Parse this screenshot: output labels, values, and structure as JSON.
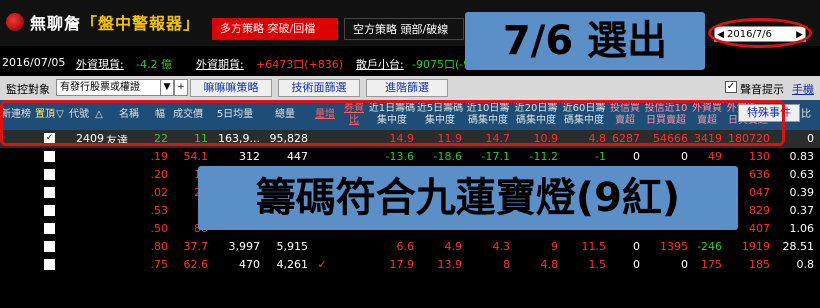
{
  "title": {
    "app_prefix": "無聊詹",
    "app_bracket_l": "「",
    "app_highlight": "盤中警報器",
    "app_bracket_r": "」",
    "bull_strategy": "多方策略  突破/回檔",
    "bear_strategy": "空方策略  頭部/破線",
    "date_value": "2016/7/6"
  },
  "overlay": {
    "top_text": "7/6 選出",
    "mid_text": "籌碼符合九蓮寶燈(9紅)"
  },
  "info": {
    "date": "2016/07/05",
    "foreign_spot_label": "外資現貨:",
    "foreign_spot_value": "-4.2 億",
    "foreign_futures_label": "外資期貨:",
    "foreign_futures_value": "+6473口(+836)",
    "retail_label": "散戶小台:",
    "retail_value": "-9075口(-987)"
  },
  "settings": {
    "monitor_label": "監控對象",
    "monitor_value": "有發行股票或權證",
    "btn_clear": "嘛嘛嘛策略",
    "btn_tech": "技術面篩選",
    "btn_advanced": "進階篩選",
    "sound_label": "聲音提示",
    "hand_label": "手機",
    "special_btn": "特殊事件"
  },
  "columns": [
    "新連榜",
    "置頂",
    "代號",
    "名稱",
    "幅",
    "成交價",
    "5日均量",
    "總量",
    "量增",
    "券資比",
    "近1日籌碼集中度",
    "近5日籌碼集中度",
    "近10日籌碼集中度",
    "近20日籌碼集中度",
    "近60日籌碼集中度",
    "投信買賣超",
    "投信近10日買賣超",
    "外資買賣超",
    "外資近10日買賣超",
    "券資比"
  ],
  "rows": [
    {
      "code": "2409",
      "name": "友達",
      "chg": "22",
      "price": "11",
      "avg5": "163,9...",
      "vol": "95,828",
      "inc": "",
      "c1": "14.9",
      "c5": "11.9",
      "c10": "14.7",
      "c20": "10.9",
      "c60": "4.8",
      "it": "6287",
      "it10": "54666",
      "fi": "3419",
      "fi10": "180720",
      "ratio": "0"
    },
    {
      "code": "",
      "name": "",
      "chg": ".19",
      "price": "54.1",
      "avg5": "312",
      "vol": "447",
      "inc": "",
      "c1": "-13.6",
      "c5": "-18.6",
      "c10": "-17.1",
      "c20": "-11.2",
      "c60": "-1",
      "it": "0",
      "it10": "0",
      "fi": "49",
      "fi10": "130",
      "ratio": "0.83"
    },
    {
      "code": "",
      "name": "",
      "chg": ".20",
      "price": "12",
      "avg5": "",
      "vol": "",
      "inc": "",
      "c1": "",
      "c5": "",
      "c10": "",
      "c20": "",
      "c60": "",
      "it": "",
      "it10": "",
      "fi": "",
      "fi10": "636",
      "ratio": "0.63"
    },
    {
      "code": "",
      "name": "",
      "chg": ".02",
      "price": "22",
      "avg5": "",
      "vol": "",
      "inc": "",
      "c1": "",
      "c5": "",
      "c10": "",
      "c20": "",
      "c60": "",
      "it": "",
      "it10": "",
      "fi": "",
      "fi10": "047",
      "ratio": "0.39"
    },
    {
      "code": "",
      "name": "",
      "chg": ".53",
      "price": "5",
      "avg5": "",
      "vol": "",
      "inc": "",
      "c1": "",
      "c5": "",
      "c10": "",
      "c20": "",
      "c60": "",
      "it": "",
      "it10": "",
      "fi": "",
      "fi10": "829",
      "ratio": "0.37"
    },
    {
      "code": "",
      "name": "",
      "chg": ".50",
      "price": "88",
      "avg5": "",
      "vol": "",
      "inc": "",
      "c1": "",
      "c5": "",
      "c10": "",
      "c20": "",
      "c60": "",
      "it": "",
      "it10": "",
      "fi": "",
      "fi10": "407",
      "ratio": "1.06"
    },
    {
      "code": "",
      "name": "",
      "chg": ".80",
      "price": "37.7",
      "avg5": "3,997",
      "vol": "5,915",
      "inc": "",
      "c1": "6.6",
      "c5": "4.9",
      "c10": "4.3",
      "c20": "9",
      "c60": "11.5",
      "it": "0",
      "it10": "1395",
      "fi": "-246",
      "fi10": "1919",
      "ratio": "28.51"
    },
    {
      "code": "",
      "name": "",
      "chg": ".75",
      "price": "62.6",
      "avg5": "470",
      "vol": "4,261",
      "inc": "✓",
      "c1": "17.9",
      "c5": "13.9",
      "c10": "8",
      "c20": "4.8",
      "c60": "1.5",
      "it": "0",
      "it10": "0",
      "fi": "175",
      "fi10": "185",
      "ratio": "0.8"
    }
  ],
  "colors": {
    "bull": "#dd0000",
    "header_bg": "#1e4e78",
    "overlay": "#5a8fc8",
    "highlight_border": "#e01010"
  }
}
